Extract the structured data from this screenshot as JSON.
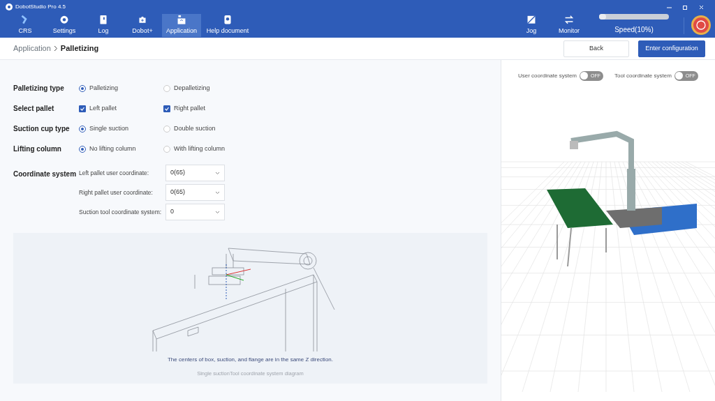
{
  "window": {
    "title": "DobotStudio Pro 4.5"
  },
  "nav": [
    {
      "label": "CRS",
      "selected": false
    },
    {
      "label": "Settings",
      "selected": false
    },
    {
      "label": "Log",
      "selected": false
    },
    {
      "label": "Dobot+",
      "selected": false
    },
    {
      "label": "Application",
      "selected": true
    },
    {
      "label": "Help document",
      "selected": false
    }
  ],
  "tools": [
    {
      "label": "Jog"
    },
    {
      "label": "Monitor"
    }
  ],
  "speed": {
    "label": "Speed(10%)",
    "level": 0.1
  },
  "breadcrumb": {
    "parent": "Application",
    "current": "Palletizing"
  },
  "buttons": [
    {
      "label": "Back",
      "kind": "secondary"
    },
    {
      "label": "Enter configuration",
      "kind": "primary"
    }
  ],
  "options": [
    {
      "label": "Palletizing type",
      "kind": "radio",
      "choices": [
        {
          "label": "Palletizing",
          "selected": true
        },
        {
          "label": "Depalletizing",
          "selected": false
        }
      ]
    },
    {
      "label": "Select pallet",
      "kind": "checkbox",
      "choices": [
        {
          "label": "Left pallet",
          "checked": true
        },
        {
          "label": "Right pallet",
          "checked": true
        }
      ]
    },
    {
      "label": "Suction cup type",
      "kind": "radio",
      "choices": [
        {
          "label": "Single suction",
          "selected": true
        },
        {
          "label": "Double suction",
          "selected": false
        }
      ]
    },
    {
      "label": "Lifting column",
      "kind": "radio",
      "choices": [
        {
          "label": "No lifting column",
          "selected": true
        },
        {
          "label": "With lifting column",
          "selected": false
        }
      ]
    }
  ],
  "coordinate_system": {
    "label": "Coordinate system",
    "fields": [
      {
        "label": "Left pallet user coordinate:",
        "value": "0(65)"
      },
      {
        "label": "Right pallet user coordinate:",
        "value": "0(65)"
      },
      {
        "label": "Suction tool coordinate system:",
        "value": "0"
      }
    ]
  },
  "diagram": {
    "note": "The centers of box, suction, and flange are in the same Z direction.",
    "caption": "Single suctionTool coordinate system diagram"
  },
  "view_toggles": [
    {
      "label": "User coordinate system",
      "state": "OFF",
      "on": false
    },
    {
      "label": "Tool coordinate system",
      "state": "OFF",
      "on": false
    }
  ]
}
